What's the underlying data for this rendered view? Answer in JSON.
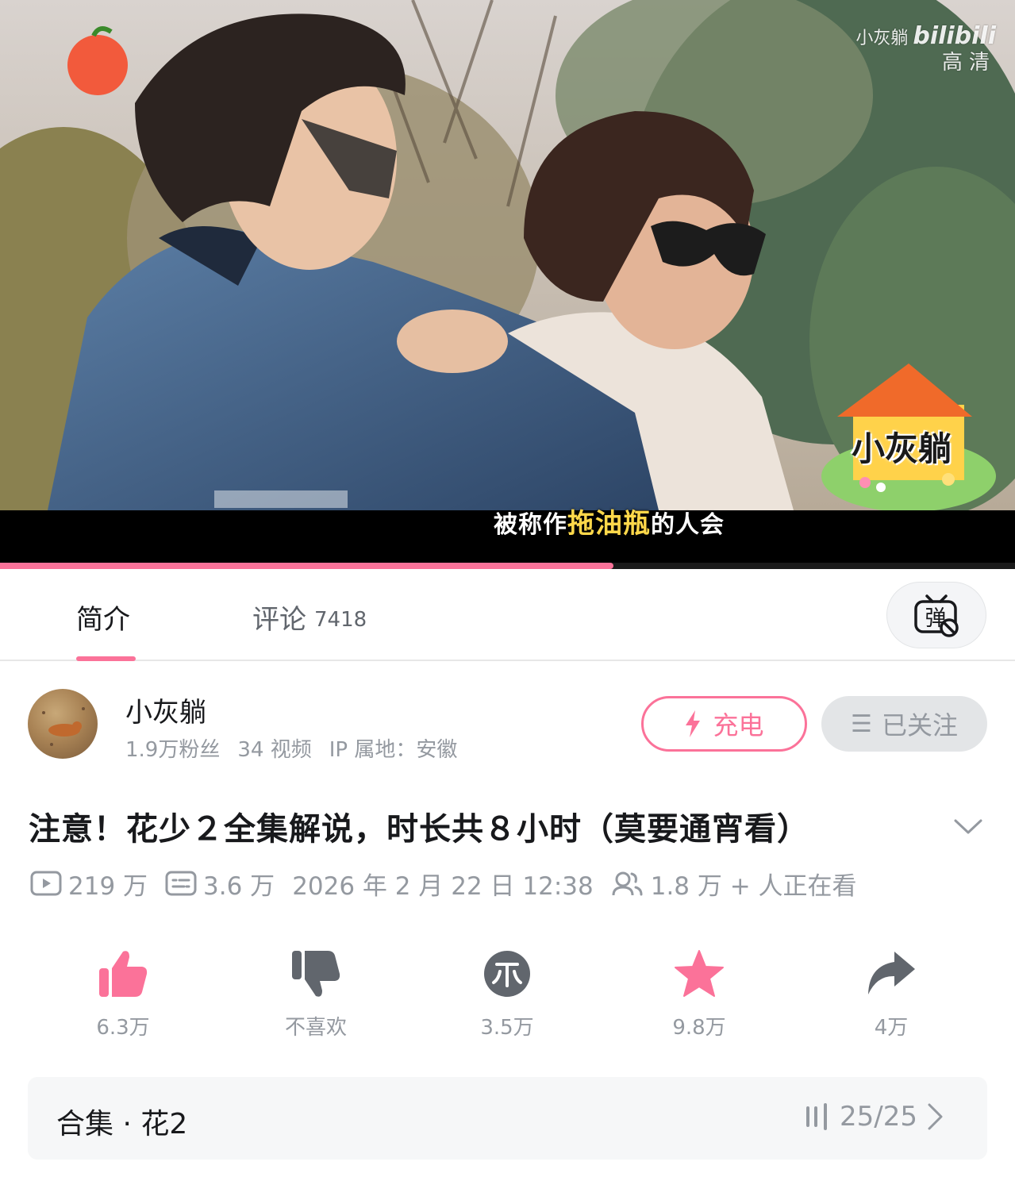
{
  "video": {
    "subtitle_pre": "被称作",
    "subtitle_highlight": "拖油瓶",
    "subtitle_post": "的人会",
    "watermark_name": "小灰躺",
    "watermark_brand": "bilibili",
    "watermark_quality": "高清",
    "sticker_text": "小灰躺",
    "progress": 0.604,
    "accent_color": "#fb7299"
  },
  "tabs": {
    "intro_label": "简介",
    "comments_label": "评论",
    "comments_count": "7418",
    "danmaku_icon": "danmaku-off-icon",
    "danmaku_glyph": "弹"
  },
  "uploader": {
    "name": "小灰躺",
    "fans": "1.9万粉丝",
    "videos": "34 视频",
    "ip": "IP 属地：安徽",
    "charge_label": "充电",
    "follow_menu_glyph": "☰",
    "follow_label": "已关注"
  },
  "video_info": {
    "title": "注意！花少２全集解说，时长共８小时（莫要通宵看）",
    "views": "219 万",
    "danmaku_count": "3.6 万",
    "date": "2026 年 2 月 22 日 12:38",
    "watching": "1.8 万 + 人正在看"
  },
  "actions": {
    "like": "6.3万",
    "dislike": "不喜欢",
    "coin": "3.5万",
    "favorite": "9.8万",
    "share": "4万"
  },
  "collection": {
    "label": "合集 · 花2",
    "progress": "25/25"
  }
}
